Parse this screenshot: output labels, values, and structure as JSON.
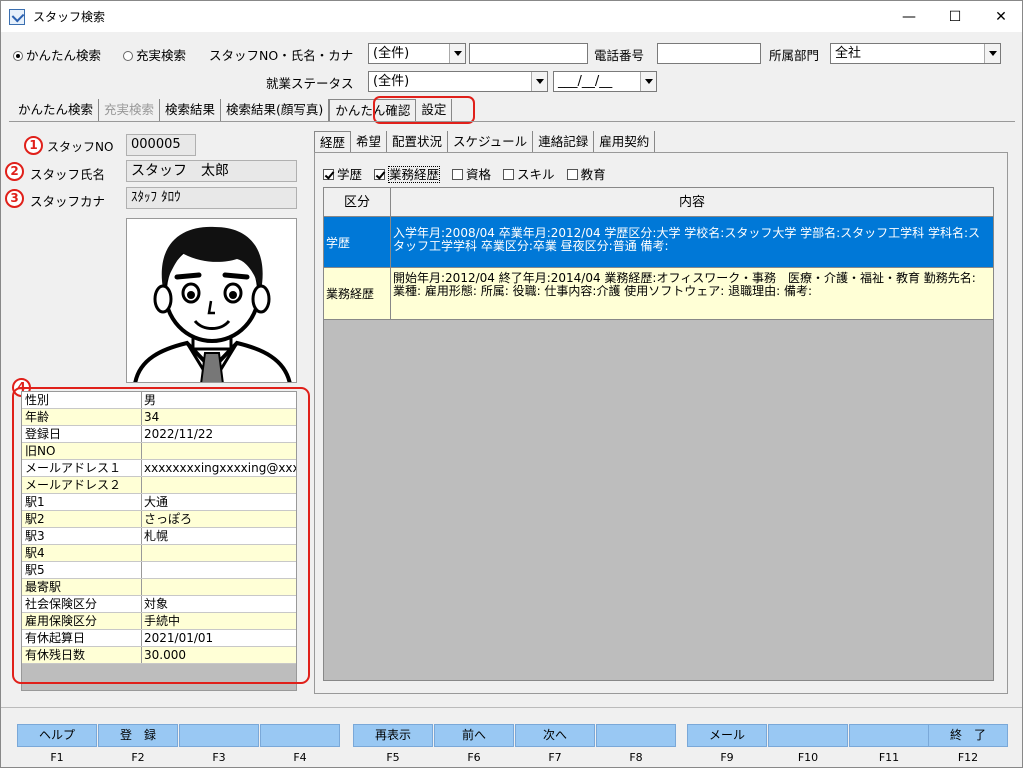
{
  "window": {
    "title": "スタッフ検索",
    "min": "—",
    "max": "☐",
    "close": "✕"
  },
  "search": {
    "radio_easy": "かんたん検索",
    "radio_full": "充実検索",
    "staff_label": "スタッフNO・氏名・カナ",
    "staff_combo": "(全件)",
    "phone_label": "電話番号",
    "dept_label": "所属部門",
    "dept_value": "全社",
    "status_label": "就業ステータス",
    "status_value": "(全件)",
    "date_value": "___/__/__"
  },
  "main_tabs": [
    "かんたん検索",
    "充実検索",
    "検索結果",
    "検索結果(顔写真)",
    "かんたん確認",
    "設定"
  ],
  "profile": {
    "no_label": "スタッフNO",
    "no_value": "000005",
    "name_label": "スタッフ氏名",
    "name_value": "スタッフ　太郎",
    "kana_label": "スタッフカナ",
    "kana_value": "ｽﾀｯﾌ ﾀﾛｳ"
  },
  "badges": [
    "1",
    "2",
    "3",
    "4"
  ],
  "info": [
    {
      "k": "性別",
      "v": "男"
    },
    {
      "k": "年齢",
      "v": "34"
    },
    {
      "k": "登録日",
      "v": "2022/11/22"
    },
    {
      "k": "旧NO",
      "v": ""
    },
    {
      "k": "メールアドレス１",
      "v": "xxxxxxxxingxxxxing@xxxx"
    },
    {
      "k": "メールアドレス２",
      "v": ""
    },
    {
      "k": "駅1",
      "v": "大通"
    },
    {
      "k": "駅2",
      "v": "さっぽろ"
    },
    {
      "k": "駅3",
      "v": "札幌"
    },
    {
      "k": "駅4",
      "v": ""
    },
    {
      "k": "駅5",
      "v": ""
    },
    {
      "k": "最寄駅",
      "v": ""
    },
    {
      "k": "社会保険区分",
      "v": "対象"
    },
    {
      "k": "雇用保険区分",
      "v": "手続中"
    },
    {
      "k": "有休起算日",
      "v": "2021/01/01"
    },
    {
      "k": "有休残日数",
      "v": "30.000"
    }
  ],
  "sub_tabs": [
    "経歴",
    "希望",
    "配置状況",
    "スケジュール",
    "連絡記録",
    "雇用契約"
  ],
  "filters": [
    {
      "label": "学歴",
      "checked": true
    },
    {
      "label": "業務経歴",
      "checked": true
    },
    {
      "label": "資格",
      "checked": false
    },
    {
      "label": "スキル",
      "checked": false
    },
    {
      "label": "教育",
      "checked": false
    }
  ],
  "grid": {
    "headers": [
      "区分",
      "内容"
    ],
    "rows": [
      {
        "c1": "学歴",
        "c2": "入学年月:2008/04 卒業年月:2012/04 学歴区分:大学 学校名:スタッフ大学 学部名:スタッフ工学科 学科名:スタッフ工学学科 卒業区分:卒業 昼夜区分:普通 備考:"
      },
      {
        "c1": "業務経歴",
        "c2": "開始年月:2012/04 終了年月:2014/04 業務経歴:オフィスワーク・事務　医療・介護・福祉・教育 勤務先名: 業種: 雇用形態: 所属: 役職: 仕事内容:介護 使用ソフトウェア: 退職理由: 備考:"
      }
    ]
  },
  "fkeys": [
    {
      "label": "ヘルプ",
      "key": "F1"
    },
    {
      "label": "登　録",
      "key": "F2"
    },
    {
      "label": "",
      "key": "F3"
    },
    {
      "label": "",
      "key": "F4"
    },
    {
      "label": "再表示",
      "key": "F5"
    },
    {
      "label": "前へ",
      "key": "F6"
    },
    {
      "label": "次へ",
      "key": "F7"
    },
    {
      "label": "",
      "key": "F8"
    },
    {
      "label": "メール",
      "key": "F9"
    },
    {
      "label": "",
      "key": "F10"
    },
    {
      "label": "",
      "key": "F11"
    },
    {
      "label": "終　了",
      "key": "F12"
    }
  ]
}
